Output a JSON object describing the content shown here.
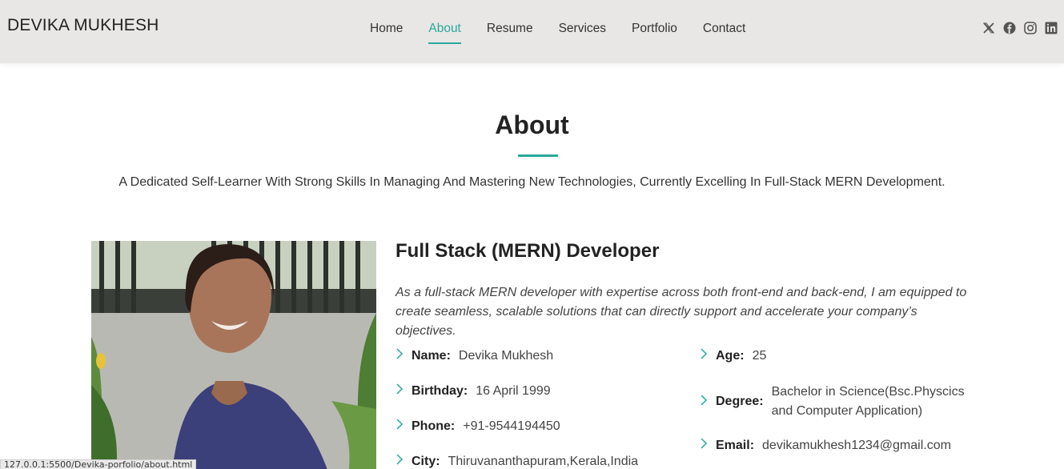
{
  "header": {
    "logo": "DEVIKA MUKHESH",
    "nav": [
      "Home",
      "About",
      "Resume",
      "Services",
      "Portfolio",
      "Contact"
    ],
    "active_nav": "About",
    "socials": [
      "x-icon",
      "facebook-icon",
      "instagram-icon",
      "linkedin-icon"
    ]
  },
  "about": {
    "title": "About",
    "subtitle": "A Dedicated Self-Learner With Strong Skills In Managing And Mastering New Technologies, Currently Excelling In Full-Stack MERN Development.",
    "role": "Full Stack (MERN) Developer",
    "description": "As a full-stack MERN developer with expertise across both front-end and back-end, I am equipped to create seamless, scalable solutions that can directly support and accelerate your company’s objectives.",
    "left_info": [
      {
        "label": "Name:",
        "value": "Devika Mukhesh"
      },
      {
        "label": "Birthday:",
        "value": "16 April 1999"
      },
      {
        "label": "Phone:",
        "value": "+91-9544194450"
      },
      {
        "label": "City:",
        "value": "Thiruvananthapuram,Kerala,India"
      }
    ],
    "right_info": [
      {
        "label": "Age:",
        "value": "25"
      },
      {
        "label": "Degree:",
        "value": "Bachelor in Science(Bsc.Physcics and Computer Application)"
      },
      {
        "label": "Email:",
        "value": "devikamukhesh1234@gmail.com"
      }
    ]
  },
  "status_bar": "127.0.0.1:5500/Devika-porfolio/about.html",
  "colors": {
    "accent": "#2aa89a",
    "header_bg": "#e8e7e6"
  }
}
